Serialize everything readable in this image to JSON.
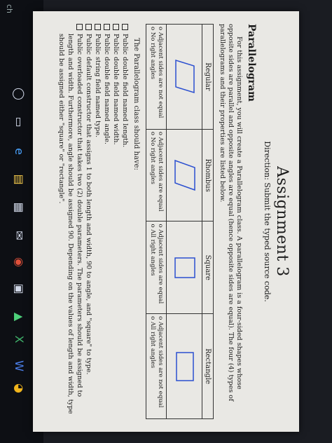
{
  "taskbar": {
    "search_fragment": "ch",
    "icons": [
      "search-icon",
      "task-view-icon",
      "edge-icon",
      "file-explorer-icon",
      "store-icon",
      "mail-icon",
      "camera-icon",
      "game-icon",
      "photo-icon",
      "excel-icon",
      "word-icon",
      "chrome-icon"
    ]
  },
  "document": {
    "title": "Assignment 3",
    "direction": "Direction: Submit the typed source code.",
    "section": "Parallelogram",
    "intro": "For this assignment, you will create a Parallelogram class. A parallelogram is a four-sided shapes whose opposite sides are parallel and opposite angles are equal (hence opposite sides are equal). The four (4) types of parallelograms and their properties are listed below.",
    "table": {
      "headers": [
        "Regular",
        "Rhombus",
        "Square",
        "Rectangle"
      ],
      "props": [
        [
          "o Adjacent sides are not equal",
          "o No right angles"
        ],
        [
          "o Adjacent sides are equal",
          "o No right angles"
        ],
        [
          "o Adjacent sides are equal",
          "o All right angles"
        ],
        [
          "o Adjacent sides are not equal",
          "o All right angles"
        ]
      ]
    },
    "class_intro": "The Parallelogram class should have:",
    "requirements": [
      "Public double field named length.",
      "Public double field named width.",
      "Public double field named angle.",
      "Public string field named type.",
      "Public default constructor that assigns 1 to both length and width, 90 to angle, and \"square\" to type.",
      "Public overloaded constructor that takes two (2) double parameters. The parameters should be assigned to length and width. Furthermore, angle should be assigned 90. Depending on the values of length and width, type should be assigned either \"square\" or \"rectangle\"."
    ]
  }
}
